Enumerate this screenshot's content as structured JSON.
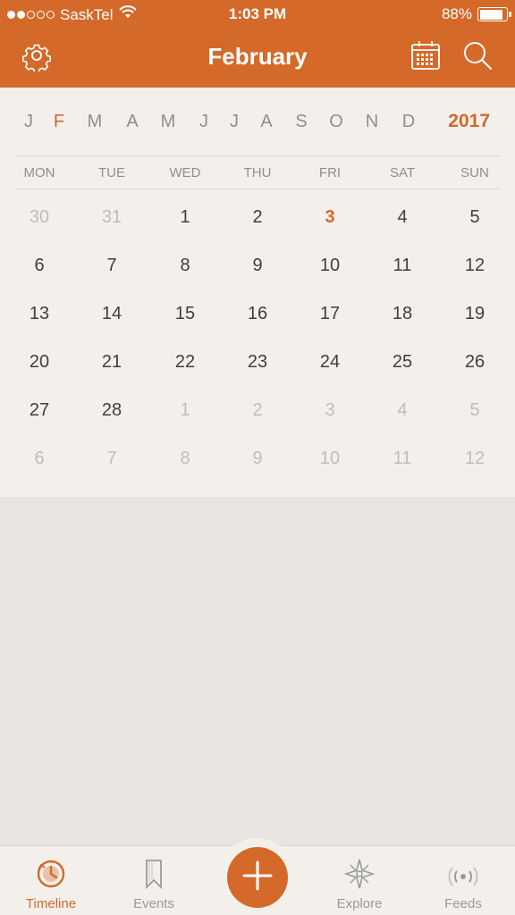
{
  "status_bar": {
    "carrier": "SaskTel",
    "signal_filled": 2,
    "signal_total": 5,
    "time": "1:03 PM",
    "battery_text": "88%",
    "battery_level": 0.88
  },
  "header": {
    "title": "February",
    "left_icon": "gear-icon",
    "right_icons": [
      "calendar-grid-icon",
      "search-icon"
    ]
  },
  "months": {
    "items": [
      "J",
      "F",
      "M",
      "A",
      "M",
      "J",
      "J",
      "A",
      "S",
      "O",
      "N",
      "D"
    ],
    "active_index": 1,
    "year": "2017"
  },
  "calendar": {
    "weekdays": [
      "MON",
      "TUE",
      "WED",
      "THU",
      "FRI",
      "SAT",
      "SUN"
    ],
    "weeks": [
      [
        {
          "d": "30",
          "o": true
        },
        {
          "d": "31",
          "o": true
        },
        {
          "d": "1"
        },
        {
          "d": "2"
        },
        {
          "d": "3",
          "today": true
        },
        {
          "d": "4"
        },
        {
          "d": "5"
        }
      ],
      [
        {
          "d": "6"
        },
        {
          "d": "7"
        },
        {
          "d": "8"
        },
        {
          "d": "9"
        },
        {
          "d": "10"
        },
        {
          "d": "11"
        },
        {
          "d": "12"
        }
      ],
      [
        {
          "d": "13"
        },
        {
          "d": "14"
        },
        {
          "d": "15"
        },
        {
          "d": "16"
        },
        {
          "d": "17"
        },
        {
          "d": "18"
        },
        {
          "d": "19"
        }
      ],
      [
        {
          "d": "20"
        },
        {
          "d": "21"
        },
        {
          "d": "22"
        },
        {
          "d": "23"
        },
        {
          "d": "24"
        },
        {
          "d": "25"
        },
        {
          "d": "26"
        }
      ],
      [
        {
          "d": "27"
        },
        {
          "d": "28"
        },
        {
          "d": "1",
          "o": true
        },
        {
          "d": "2",
          "o": true
        },
        {
          "d": "3",
          "o": true
        },
        {
          "d": "4",
          "o": true
        },
        {
          "d": "5",
          "o": true
        }
      ],
      [
        {
          "d": "6",
          "o": true
        },
        {
          "d": "7",
          "o": true
        },
        {
          "d": "8",
          "o": true
        },
        {
          "d": "9",
          "o": true
        },
        {
          "d": "10",
          "o": true
        },
        {
          "d": "11",
          "o": true
        },
        {
          "d": "12",
          "o": true
        }
      ]
    ]
  },
  "tabbar": {
    "tabs": [
      {
        "label": "Timeline",
        "icon": "timeline-clock-icon",
        "active": true
      },
      {
        "label": "Events",
        "icon": "bookmark-icon",
        "active": false
      },
      {
        "label": "Explore",
        "icon": "compass-star-icon",
        "active": false
      },
      {
        "label": "Feeds",
        "icon": "feeds-icon",
        "active": false
      }
    ],
    "add_icon": "plus-icon"
  },
  "colors": {
    "accent": "#d4692a",
    "background": "#f3f0ec",
    "empty_area": "#e8e5e0"
  }
}
